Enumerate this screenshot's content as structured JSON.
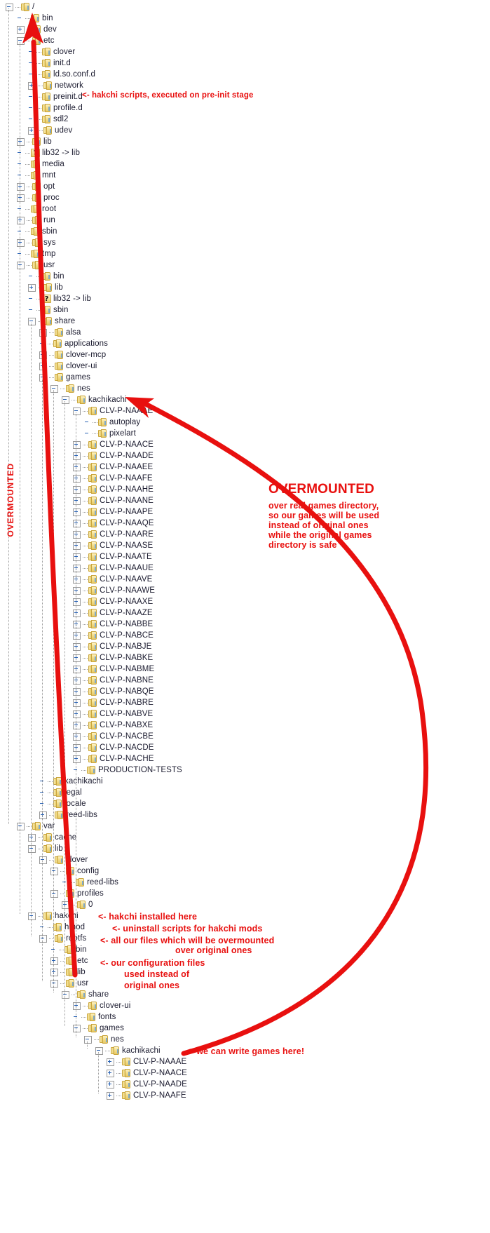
{
  "view": {
    "kind": "file-tree",
    "accent_red": "#e8100f",
    "text_color": "#1b1b2f",
    "folder_color": "#e7c964",
    "background": "#ffffff"
  },
  "tree": [
    {
      "label": "/",
      "depth": 0,
      "icon": "folder",
      "expander": "minus"
    },
    {
      "label": "bin",
      "depth": 1,
      "icon": "folder",
      "expander": "none"
    },
    {
      "label": "dev",
      "depth": 1,
      "icon": "folder",
      "expander": "plus"
    },
    {
      "label": "etc",
      "depth": 1,
      "icon": "folder",
      "expander": "minus"
    },
    {
      "label": "clover",
      "depth": 2,
      "icon": "folder",
      "expander": "none"
    },
    {
      "label": "init.d",
      "depth": 2,
      "icon": "folder",
      "expander": "none"
    },
    {
      "label": "ld.so.conf.d",
      "depth": 2,
      "icon": "folder",
      "expander": "none"
    },
    {
      "label": "network",
      "depth": 2,
      "icon": "folder",
      "expander": "plus"
    },
    {
      "label": "preinit.d",
      "depth": 2,
      "icon": "folder",
      "expander": "none"
    },
    {
      "label": "profile.d",
      "depth": 2,
      "icon": "folder",
      "expander": "none"
    },
    {
      "label": "sdl2",
      "depth": 2,
      "icon": "folder",
      "expander": "none"
    },
    {
      "label": "udev",
      "depth": 2,
      "icon": "folder",
      "expander": "plus"
    },
    {
      "label": "lib",
      "depth": 1,
      "icon": "folder",
      "expander": "plus"
    },
    {
      "label": "lib32 -> lib",
      "depth": 1,
      "icon": "symlink",
      "expander": "none"
    },
    {
      "label": "media",
      "depth": 1,
      "icon": "folder",
      "expander": "none"
    },
    {
      "label": "mnt",
      "depth": 1,
      "icon": "folder",
      "expander": "none"
    },
    {
      "label": "opt",
      "depth": 1,
      "icon": "folder",
      "expander": "plus"
    },
    {
      "label": "proc",
      "depth": 1,
      "icon": "folder",
      "expander": "plus"
    },
    {
      "label": "root",
      "depth": 1,
      "icon": "folder",
      "expander": "none"
    },
    {
      "label": "run",
      "depth": 1,
      "icon": "folder",
      "expander": "plus"
    },
    {
      "label": "sbin",
      "depth": 1,
      "icon": "folder",
      "expander": "none"
    },
    {
      "label": "sys",
      "depth": 1,
      "icon": "folder",
      "expander": "plus"
    },
    {
      "label": "tmp",
      "depth": 1,
      "icon": "folder",
      "expander": "none"
    },
    {
      "label": "usr",
      "depth": 1,
      "icon": "folder",
      "expander": "minus"
    },
    {
      "label": "bin",
      "depth": 2,
      "icon": "folder",
      "expander": "none"
    },
    {
      "label": "lib",
      "depth": 2,
      "icon": "folder",
      "expander": "plus"
    },
    {
      "label": "lib32 -> lib",
      "depth": 2,
      "icon": "symlink",
      "expander": "none"
    },
    {
      "label": "sbin",
      "depth": 2,
      "icon": "folder",
      "expander": "none"
    },
    {
      "label": "share",
      "depth": 2,
      "icon": "folder",
      "expander": "minus"
    },
    {
      "label": "alsa",
      "depth": 3,
      "icon": "folder",
      "expander": "plus"
    },
    {
      "label": "applications",
      "depth": 3,
      "icon": "folder",
      "expander": "none"
    },
    {
      "label": "clover-mcp",
      "depth": 3,
      "icon": "folder",
      "expander": "plus"
    },
    {
      "label": "clover-ui",
      "depth": 3,
      "icon": "folder",
      "expander": "plus"
    },
    {
      "label": "games",
      "depth": 3,
      "icon": "folder",
      "expander": "minus"
    },
    {
      "label": "nes",
      "depth": 4,
      "icon": "folder",
      "expander": "minus"
    },
    {
      "label": "kachikachi",
      "depth": 5,
      "icon": "folder",
      "expander": "minus"
    },
    {
      "label": "CLV-P-NAAAE",
      "depth": 6,
      "icon": "folder",
      "expander": "minus"
    },
    {
      "label": "autoplay",
      "depth": 7,
      "icon": "folder",
      "expander": "none"
    },
    {
      "label": "pixelart",
      "depth": 7,
      "icon": "folder",
      "expander": "none"
    },
    {
      "label": "CLV-P-NAACE",
      "depth": 6,
      "icon": "folder",
      "expander": "plus"
    },
    {
      "label": "CLV-P-NAADE",
      "depth": 6,
      "icon": "folder",
      "expander": "plus"
    },
    {
      "label": "CLV-P-NAAEE",
      "depth": 6,
      "icon": "folder",
      "expander": "plus"
    },
    {
      "label": "CLV-P-NAAFE",
      "depth": 6,
      "icon": "folder",
      "expander": "plus"
    },
    {
      "label": "CLV-P-NAAHE",
      "depth": 6,
      "icon": "folder",
      "expander": "plus"
    },
    {
      "label": "CLV-P-NAANE",
      "depth": 6,
      "icon": "folder",
      "expander": "plus"
    },
    {
      "label": "CLV-P-NAAPE",
      "depth": 6,
      "icon": "folder",
      "expander": "plus"
    },
    {
      "label": "CLV-P-NAAQE",
      "depth": 6,
      "icon": "folder",
      "expander": "plus"
    },
    {
      "label": "CLV-P-NAARE",
      "depth": 6,
      "icon": "folder",
      "expander": "plus"
    },
    {
      "label": "CLV-P-NAASE",
      "depth": 6,
      "icon": "folder",
      "expander": "plus"
    },
    {
      "label": "CLV-P-NAATE",
      "depth": 6,
      "icon": "folder",
      "expander": "plus"
    },
    {
      "label": "CLV-P-NAAUE",
      "depth": 6,
      "icon": "folder",
      "expander": "plus"
    },
    {
      "label": "CLV-P-NAAVE",
      "depth": 6,
      "icon": "folder",
      "expander": "plus"
    },
    {
      "label": "CLV-P-NAAWE",
      "depth": 6,
      "icon": "folder",
      "expander": "plus"
    },
    {
      "label": "CLV-P-NAAXE",
      "depth": 6,
      "icon": "folder",
      "expander": "plus"
    },
    {
      "label": "CLV-P-NAAZE",
      "depth": 6,
      "icon": "folder",
      "expander": "plus"
    },
    {
      "label": "CLV-P-NABBE",
      "depth": 6,
      "icon": "folder",
      "expander": "plus"
    },
    {
      "label": "CLV-P-NABCE",
      "depth": 6,
      "icon": "folder",
      "expander": "plus"
    },
    {
      "label": "CLV-P-NABJE",
      "depth": 6,
      "icon": "folder",
      "expander": "plus"
    },
    {
      "label": "CLV-P-NABKE",
      "depth": 6,
      "icon": "folder",
      "expander": "plus"
    },
    {
      "label": "CLV-P-NABME",
      "depth": 6,
      "icon": "folder",
      "expander": "plus"
    },
    {
      "label": "CLV-P-NABNE",
      "depth": 6,
      "icon": "folder",
      "expander": "plus"
    },
    {
      "label": "CLV-P-NABQE",
      "depth": 6,
      "icon": "folder",
      "expander": "plus"
    },
    {
      "label": "CLV-P-NABRE",
      "depth": 6,
      "icon": "folder",
      "expander": "plus"
    },
    {
      "label": "CLV-P-NABVE",
      "depth": 6,
      "icon": "folder",
      "expander": "plus"
    },
    {
      "label": "CLV-P-NABXE",
      "depth": 6,
      "icon": "folder",
      "expander": "plus"
    },
    {
      "label": "CLV-P-NACBE",
      "depth": 6,
      "icon": "folder",
      "expander": "plus"
    },
    {
      "label": "CLV-P-NACDE",
      "depth": 6,
      "icon": "folder",
      "expander": "plus"
    },
    {
      "label": "CLV-P-NACHE",
      "depth": 6,
      "icon": "folder",
      "expander": "plus"
    },
    {
      "label": "PRODUCTION-TESTS",
      "depth": 6,
      "icon": "folder",
      "expander": "none"
    },
    {
      "label": "kachikachi",
      "depth": 3,
      "icon": "folder",
      "expander": "none"
    },
    {
      "label": "legal",
      "depth": 3,
      "icon": "folder",
      "expander": "none"
    },
    {
      "label": "locale",
      "depth": 3,
      "icon": "folder",
      "expander": "none"
    },
    {
      "label": "reed-libs",
      "depth": 3,
      "icon": "folder",
      "expander": "plus"
    },
    {
      "label": "var",
      "depth": 1,
      "icon": "folder",
      "expander": "minus"
    },
    {
      "label": "cache",
      "depth": 2,
      "icon": "folder",
      "expander": "plus"
    },
    {
      "label": "lib",
      "depth": 2,
      "icon": "folder",
      "expander": "minus"
    },
    {
      "label": "clover",
      "depth": 3,
      "icon": "folder",
      "expander": "minus"
    },
    {
      "label": "config",
      "depth": 4,
      "icon": "folder",
      "expander": "minus"
    },
    {
      "label": "reed-libs",
      "depth": 5,
      "icon": "folder",
      "expander": "none"
    },
    {
      "label": "profiles",
      "depth": 4,
      "icon": "folder",
      "expander": "minus"
    },
    {
      "label": "0",
      "depth": 5,
      "icon": "folder",
      "expander": "plus"
    },
    {
      "label": "hakchi",
      "depth": 2,
      "icon": "folder",
      "expander": "minus"
    },
    {
      "label": "hmod",
      "depth": 3,
      "icon": "folder",
      "expander": "none"
    },
    {
      "label": "rootfs",
      "depth": 3,
      "icon": "folder",
      "expander": "minus"
    },
    {
      "label": "bin",
      "depth": 4,
      "icon": "folder",
      "expander": "none"
    },
    {
      "label": "etc",
      "depth": 4,
      "icon": "folder",
      "expander": "plus"
    },
    {
      "label": "lib",
      "depth": 4,
      "icon": "folder",
      "expander": "plus"
    },
    {
      "label": "usr",
      "depth": 4,
      "icon": "folder",
      "expander": "minus"
    },
    {
      "label": "share",
      "depth": 5,
      "icon": "folder",
      "expander": "minus"
    },
    {
      "label": "clover-ui",
      "depth": 6,
      "icon": "folder",
      "expander": "plus"
    },
    {
      "label": "fonts",
      "depth": 6,
      "icon": "folder",
      "expander": "none"
    },
    {
      "label": "games",
      "depth": 6,
      "icon": "folder",
      "expander": "minus"
    },
    {
      "label": "nes",
      "depth": 7,
      "icon": "folder",
      "expander": "minus"
    },
    {
      "label": "kachikachi",
      "depth": 8,
      "icon": "folder",
      "expander": "minus"
    },
    {
      "label": "CLV-P-NAAAE",
      "depth": 9,
      "icon": "folder",
      "expander": "plus"
    },
    {
      "label": "CLV-P-NAACE",
      "depth": 9,
      "icon": "folder",
      "expander": "plus"
    },
    {
      "label": "CLV-P-NAADE",
      "depth": 9,
      "icon": "folder",
      "expander": "plus"
    },
    {
      "label": "CLV-P-NAAFE",
      "depth": 9,
      "icon": "folder",
      "expander": "plus"
    }
  ],
  "annotations": {
    "preinit": "<- hakchi scripts, executed on pre-init stage",
    "overmounted_vertical": "OVERMOUNTED",
    "overmounted_title": "OVERMOUNTED",
    "overmounted_body_1": "over real games directory,",
    "overmounted_body_2": "so our games will be used",
    "overmounted_body_3": "instead of original ones",
    "overmounted_body_4": "while the original games",
    "overmounted_body_5": "directory is safe",
    "hakchi_installed": "<- hakchi installed here",
    "hmod_note": "<- uninstall scripts for hakchi mods",
    "rootfs_note_1": "<- all our files which will be overmounted",
    "rootfs_note_2": "over original ones",
    "etc_note_1": "<- our configuration files",
    "etc_note_2": "used instead of",
    "etc_note_3": "original ones",
    "write_games_here": "<- we can write games here!"
  }
}
